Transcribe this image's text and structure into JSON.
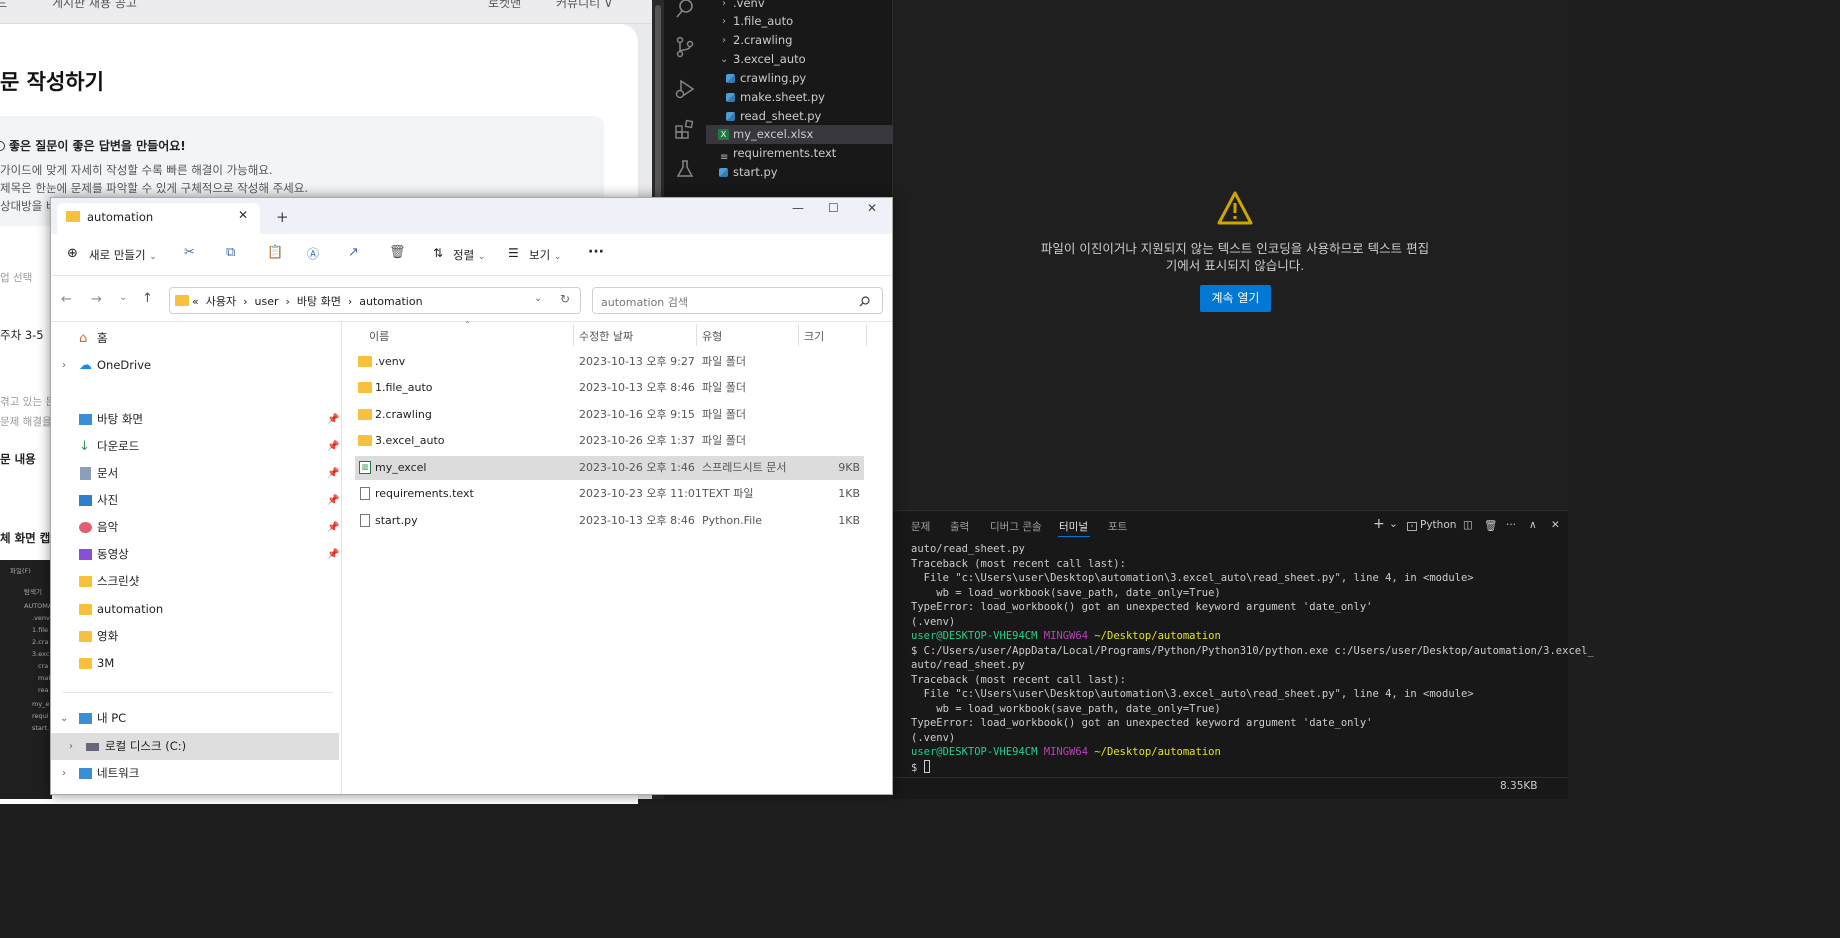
{
  "browser": {
    "top_tabs": [
      "드",
      "게시판 채용 공고",
      "로켓맨",
      "커뮤니티 ∨"
    ],
    "page_title": "문 작성하기",
    "tip_heading": "좋은 질문이 좋은 답변을 만들어요!",
    "tip_lines": [
      "가이드에 맞게 자세히 작성할 수록 빠른 해결이 가능해요.",
      "제목은 한눈에 문제를 파악할 수 있게 구체적으로 작성해 주세요.",
      "상대방을 배"
    ],
    "side_labels": [
      "업 선택",
      "주차 3-5",
      "겪고 있는 문",
      "문제 해결을",
      "문 내용",
      "체 화면 캡"
    ],
    "mini": [
      "파일(F)",
      "탐색기",
      "AUTOMA",
      ".venv",
      "1.file",
      "2.cra",
      "3.exc",
      "cra",
      "mak",
      "rea",
      "my_e",
      "requi",
      "start."
    ]
  },
  "vscode": {
    "tree": [
      {
        "label": ".venv",
        "type": "folder",
        "expanded": false
      },
      {
        "label": "1.file_auto",
        "type": "folder",
        "expanded": false
      },
      {
        "label": "2.crawling",
        "type": "folder",
        "expanded": false
      },
      {
        "label": "3.excel_auto",
        "type": "folder",
        "expanded": true
      },
      {
        "label": "crawling.py",
        "type": "py"
      },
      {
        "label": "make.sheet.py",
        "type": "py"
      },
      {
        "label": "read_sheet.py",
        "type": "py"
      },
      {
        "label": "my_excel.xlsx",
        "type": "xlsx",
        "selected": true
      },
      {
        "label": "requirements.text",
        "type": "txt"
      },
      {
        "label": "start.py",
        "type": "py"
      }
    ],
    "warning_text": "파일이 이진이거나 지원되지 않는 텍스트 인코딩을 사용하므로 텍스트 편집기에서 표시되지 않습니다.",
    "open_anyway": "계속 열기",
    "panel_tabs": [
      "문제",
      "출력",
      "디버그 콘솔",
      "터미널",
      "포트"
    ],
    "active_panel_tab": "터미널",
    "shell_label": "Python",
    "terminal": {
      "l1": "auto/read_sheet.py",
      "l2": "Traceback (most recent call last):",
      "l3": "  File \"c:\\Users\\user\\Desktop\\automation\\3.excel_auto\\read_sheet.py\", line 4, in <module>",
      "l4": "    wb = load_workbook(save_path, date_only=True)",
      "l5": "TypeError: load_workbook() got an unexpected keyword argument 'date_only'",
      "l6": "(.venv)",
      "prompt_user": "user@DESKTOP-VHE94CM",
      "prompt_env": "MINGW64",
      "prompt_path": "~/Desktop/automation",
      "cmd": "$ C:/Users/user/AppData/Local/Programs/Python/Python310/python.exe c:/Users/user/Desktop/automation/3.excel_",
      "l8": "auto/read_sheet.py",
      "l9": "Traceback (most recent call last):",
      "l10": "  File \"c:\\Users\\user\\Desktop\\automation\\3.excel_auto\\read_sheet.py\", line 4, in <module>",
      "l11": "    wb = load_workbook(save_path, date_only=True)",
      "l12": "TypeError: load_workbook() got an unexpected keyword argument 'date_only'",
      "l13": "(.venv)",
      "last_prompt": "$ "
    },
    "status_size": "8.35KB"
  },
  "explorer": {
    "tab_title": "automation",
    "toolbar": {
      "new": "새로 만들기",
      "sort": "정렬",
      "view": "보기"
    },
    "breadcrumb": [
      "«",
      "사용자",
      "user",
      "바탕 화면",
      "automation"
    ],
    "search_placeholder": "automation 검색",
    "nav": {
      "home": "홈",
      "onedrive": "OneDrive",
      "desktop": "바탕 화면",
      "downloads": "다운로드",
      "documents": "문서",
      "pictures": "사진",
      "music": "음악",
      "videos": "동영상",
      "screenshots": "스크린샷",
      "automation": "automation",
      "movies": "영화",
      "three_m": "3M",
      "this_pc": "내 PC",
      "local_disk": "로컬 디스크 (C:)",
      "network": "네트워크"
    },
    "columns": {
      "name": "이름",
      "modified": "수정한 날짜",
      "type": "유형",
      "size": "크기"
    },
    "files": [
      {
        "name": ".venv",
        "modified": "2023-10-13 오후 9:27",
        "type": "파일 폴더",
        "size": "",
        "icon": "folder"
      },
      {
        "name": "1.file_auto",
        "modified": "2023-10-13 오후 8:46",
        "type": "파일 폴더",
        "size": "",
        "icon": "folder"
      },
      {
        "name": "2.crawling",
        "modified": "2023-10-16 오후 9:15",
        "type": "파일 폴더",
        "size": "",
        "icon": "folder"
      },
      {
        "name": "3.excel_auto",
        "modified": "2023-10-26 오후 1:37",
        "type": "파일 폴더",
        "size": "",
        "icon": "folder"
      },
      {
        "name": "my_excel",
        "modified": "2023-10-26 오후 1:46",
        "type": "스프레드시트 문서",
        "size": "9KB",
        "icon": "spreadsheet",
        "selected": true
      },
      {
        "name": "requirements.text",
        "modified": "2023-10-23 오후 11:01",
        "type": "TEXT 파일",
        "size": "1KB",
        "icon": "text"
      },
      {
        "name": "start.py",
        "modified": "2023-10-13 오후 8:46",
        "type": "Python.File",
        "size": "1KB",
        "icon": "text"
      }
    ]
  },
  "colors": {
    "accent": "#0078d4",
    "folder": "#f8c13d",
    "warning": "#cca700"
  }
}
